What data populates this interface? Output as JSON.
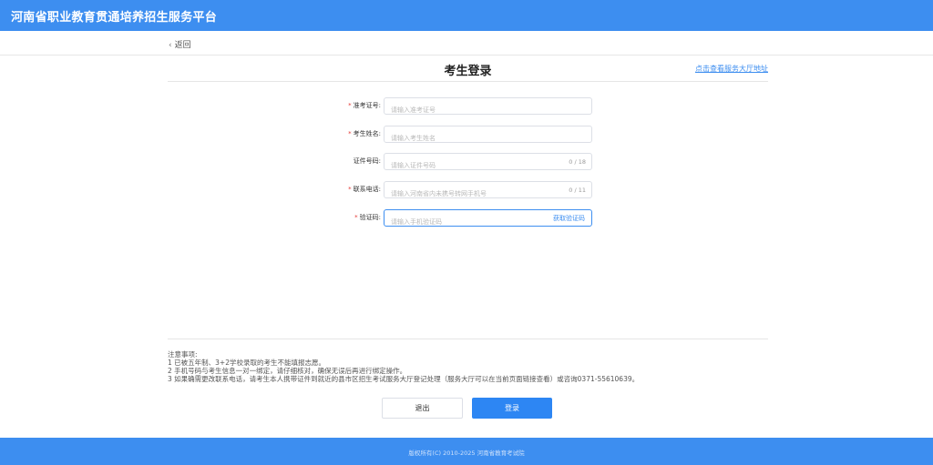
{
  "header": {
    "title": "河南省职业教育贯通培养招生服务平台"
  },
  "nav": {
    "back_label": "返回",
    "back_icon": "chevron-left-icon"
  },
  "page": {
    "title": "考生登录",
    "hall_link": "点击查看服务大厅地址"
  },
  "form": {
    "admission_no": {
      "label": "准考证号:",
      "required": "*",
      "placeholder": "请输入准考证号",
      "value": ""
    },
    "name": {
      "label": "考生姓名:",
      "required": "*",
      "placeholder": "请输入考生姓名",
      "value": ""
    },
    "id_no": {
      "label": "证件号码:",
      "placeholder": "请输入证件号码",
      "value": "",
      "counter": "0 / 18"
    },
    "phone": {
      "label": "联系电话:",
      "required": "*",
      "placeholder": "请输入河南省内未携号转网手机号",
      "value": "",
      "counter": "0 / 11"
    },
    "code": {
      "label": "验证码:",
      "required": "*",
      "placeholder": "请输入手机验证码",
      "value": "",
      "get_code": "获取验证码"
    }
  },
  "notes": [
    "注意事项:",
    "1 已被五年制、3+2学校录取的考生不能填报志愿。",
    "2 手机号码与考生信息一对一绑定，请仔细核对，确保无误后再进行绑定操作。",
    "3 如果确需更改联系电话，请考生本人携带证件到就近的县市区招生考试服务大厅登记处理（服务大厅可以在当前页面链接查看）或咨询0371-55610639。"
  ],
  "buttons": {
    "exit": "退出",
    "login": "登录"
  },
  "footer": {
    "copyright": "版权所有(C) 2010-2025 河南省教育考试院"
  },
  "colors": {
    "primary": "#3d8ef0",
    "button": "#2d86f3",
    "required": "#e53935"
  }
}
